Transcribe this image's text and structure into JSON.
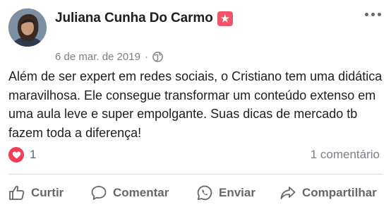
{
  "post": {
    "author": "Juliana Cunha Do Carmo",
    "badge_icon": "star-badge-icon",
    "date": "6 de mar. de 2019",
    "separator": "·",
    "privacy_icon": "globe-icon",
    "text": "Além de ser expert em redes sociais, o Cristiano tem uma didática maravilhosa. Ele consegue transformar um conteúdo extenso em uma aula leve e super empolgante. Suas dicas de mercado tb fazem toda a diferença!",
    "reaction_icon": "heart-icon",
    "reaction_count": "1",
    "comments_count": "1 comentário"
  },
  "actions": {
    "like": "Curtir",
    "comment": "Comentar",
    "send": "Enviar",
    "share": "Compartilhar"
  },
  "colors": {
    "badge": "#f35369",
    "heart": "#f33e58",
    "muted_text": "#7a7f87",
    "action_text": "#65676b"
  }
}
